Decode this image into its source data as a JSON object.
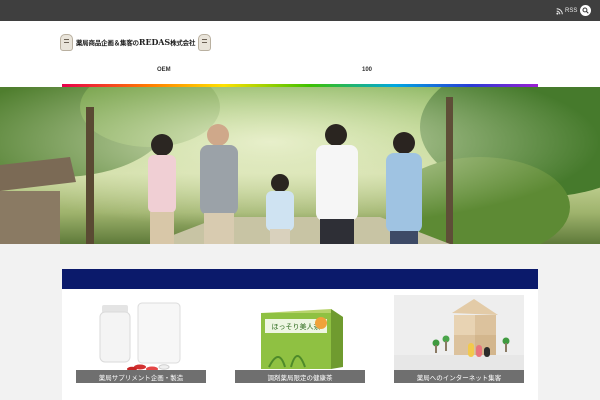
{
  "topbar": {
    "rss_label": "RSS"
  },
  "header": {
    "logo_text": "薬局商品企画＆集客の",
    "logo_brand": "REDAS",
    "logo_suffix": "株式会社",
    "nav": [
      {
        "label": "OEM"
      },
      {
        "label": "100"
      }
    ]
  },
  "services": [
    {
      "label": "薬局サプリメント企画・製造"
    },
    {
      "label": "調剤薬局限定の健康茶"
    },
    {
      "label": "薬局へのインターネット集客"
    }
  ],
  "products": {
    "tea_package_text": "ほっそり美人茶"
  },
  "colors": {
    "topbar": "#3f3f3f",
    "panel_bar": "#0b1a6b",
    "label_bg": "#6f6f6f"
  }
}
